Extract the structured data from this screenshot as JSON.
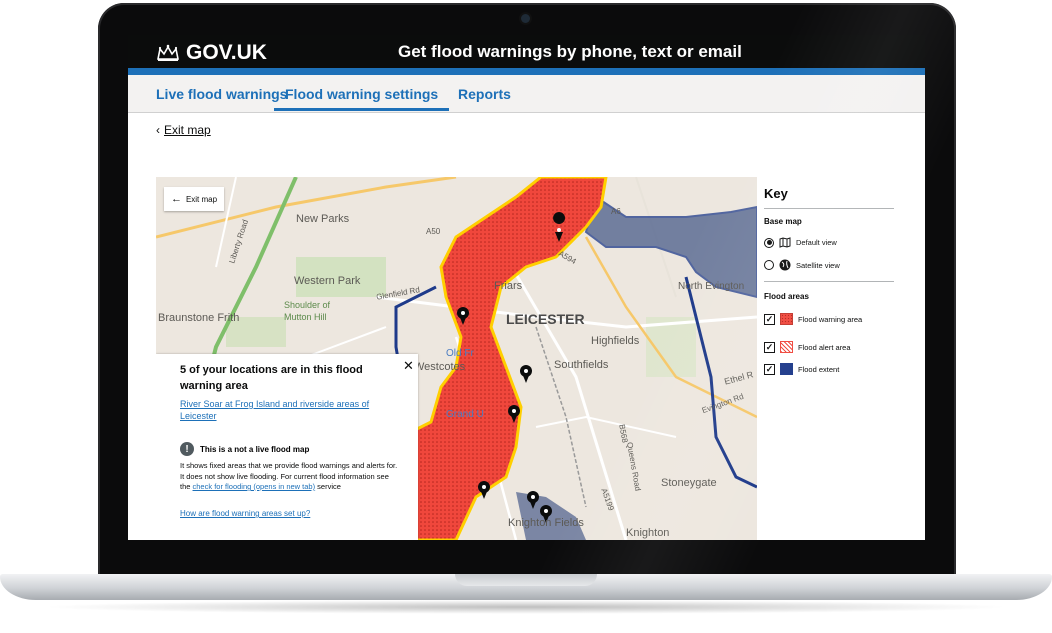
{
  "header": {
    "logo_text": "GOV.UK",
    "service_name": "Get flood warnings by phone, text or email"
  },
  "tabs": [
    {
      "label": "Live flood warnings",
      "active": false
    },
    {
      "label": "Flood warning settings",
      "active": true
    },
    {
      "label": "Reports",
      "active": false
    }
  ],
  "exit_link": "Exit map",
  "map": {
    "exit_button": "Exit map",
    "labels": [
      "New Parks",
      "Western Park",
      "Shoulder of",
      "Mutton Hill",
      "Braunstone Frith",
      "Friars",
      "LEICESTER",
      "Highfields",
      "Southfields",
      "Stoneygate",
      "Knighton",
      "Knighton Fields",
      "Westcotes",
      "Old Fr",
      "Grand U",
      "Glenfield Rd",
      "Liberty Road",
      "Evington Rd",
      "North Evington",
      "Ethel R",
      "A50",
      "A594",
      "A5199",
      "A6",
      "B568",
      "Queens Road"
    ]
  },
  "info_panel": {
    "title": "5 of your locations are in this flood warning  area",
    "close_icon": "close-icon",
    "location_link": "River Soar at Frog Island and riverside areas of Leicester",
    "warning_heading": "This is a not a live flood map",
    "warning_body_1": "It shows fixed areas that we provide flood warnings and alerts for. It does not show live flooding. For current flood information see the ",
    "warning_link": "check for flooding (opens in new tab)",
    "warning_body_2": " service",
    "bottom_link": "How are flood warning areas set up?"
  },
  "key": {
    "title": "Key",
    "base_map_heading": "Base map",
    "base_map_options": [
      {
        "label": "Default view",
        "selected": true,
        "icon": "map-icon"
      },
      {
        "label": "Satellite view",
        "selected": false,
        "icon": "globe-icon"
      }
    ],
    "flood_areas_heading": "Flood areas",
    "flood_areas": [
      {
        "label": "Flood warning area",
        "checked": true
      },
      {
        "label": "Flood alert area",
        "checked": true
      },
      {
        "label": "Flood extent",
        "checked": true
      }
    ]
  },
  "colors": {
    "govuk_black": "#0b0c0c",
    "govuk_blue": "#1d70b8",
    "warning_red": "#f0473c",
    "alert_yellow": "#ffcf00",
    "extent_blue": "#1e3a8a"
  }
}
